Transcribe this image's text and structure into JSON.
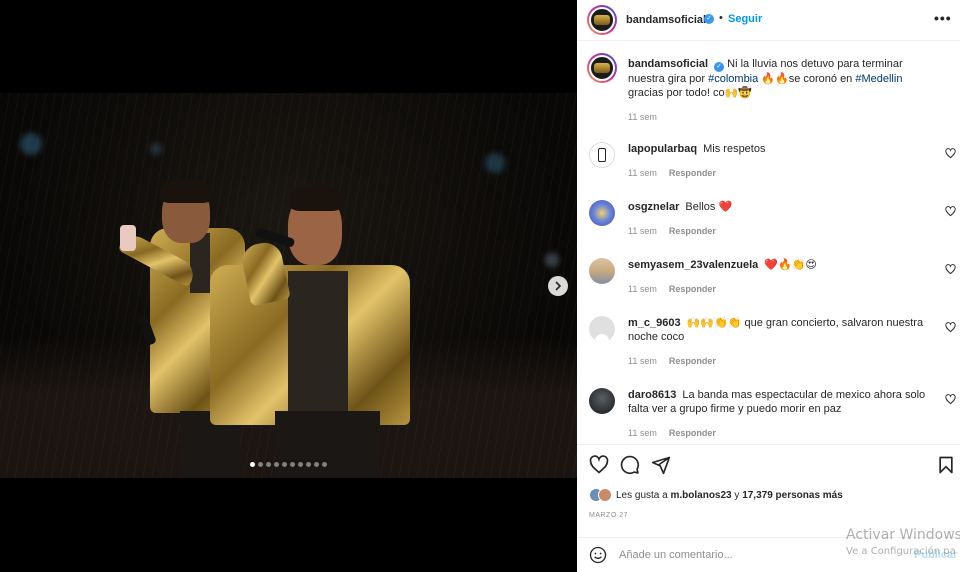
{
  "post": {
    "username": "bandamsoficial",
    "follow_label": "Seguir",
    "caption_text": "Ni la lluvia nos detuvo para terminar nuestra gira por ",
    "caption_hashtag1": "#colombia",
    "caption_mid": " 🔥🔥se coronó en ",
    "caption_hashtag2": "#Medellin",
    "caption_end": " gracias por todo! co🙌🤠",
    "caption_time": "11 sem"
  },
  "comments": [
    {
      "username": "lapopularbaq",
      "text": "Mis respetos",
      "time": "11 sem",
      "reply": "Responder"
    },
    {
      "username": "osgznelar",
      "text": "Bellos ❤️",
      "time": "11 sem",
      "reply": "Responder"
    },
    {
      "username": "semyasem_23valenzuela",
      "text": "❤️🔥👏😍",
      "time": "11 sem",
      "reply": "Responder"
    },
    {
      "username": "m_c_9603",
      "text": "🙌🙌👏👏 que gran concierto, salvaron nuestra noche coco",
      "time": "11 sem",
      "reply": "Responder"
    },
    {
      "username": "daro8613",
      "text": "La banda mas espectacular de mexico ahora solo falta ver a grupo firme y puedo morir en paz",
      "time": "11 sem",
      "reply": "Responder"
    }
  ],
  "likes": {
    "prefix": "Les gusta a ",
    "user": "m.bolanos23",
    "middle": " y ",
    "count": "17,379 personas más"
  },
  "date": "MARZO 27",
  "add_comment": {
    "placeholder": "Añade un comentario...",
    "publish": "Publicar"
  },
  "carousel": {
    "total": 10,
    "active": 0
  },
  "watermark": {
    "line1": "Activar Windows",
    "line2": "Ve a Configuración pa"
  },
  "colors": {
    "link": "#0095f6",
    "hashtag": "#00376b",
    "heart_red": "#ed4956"
  }
}
